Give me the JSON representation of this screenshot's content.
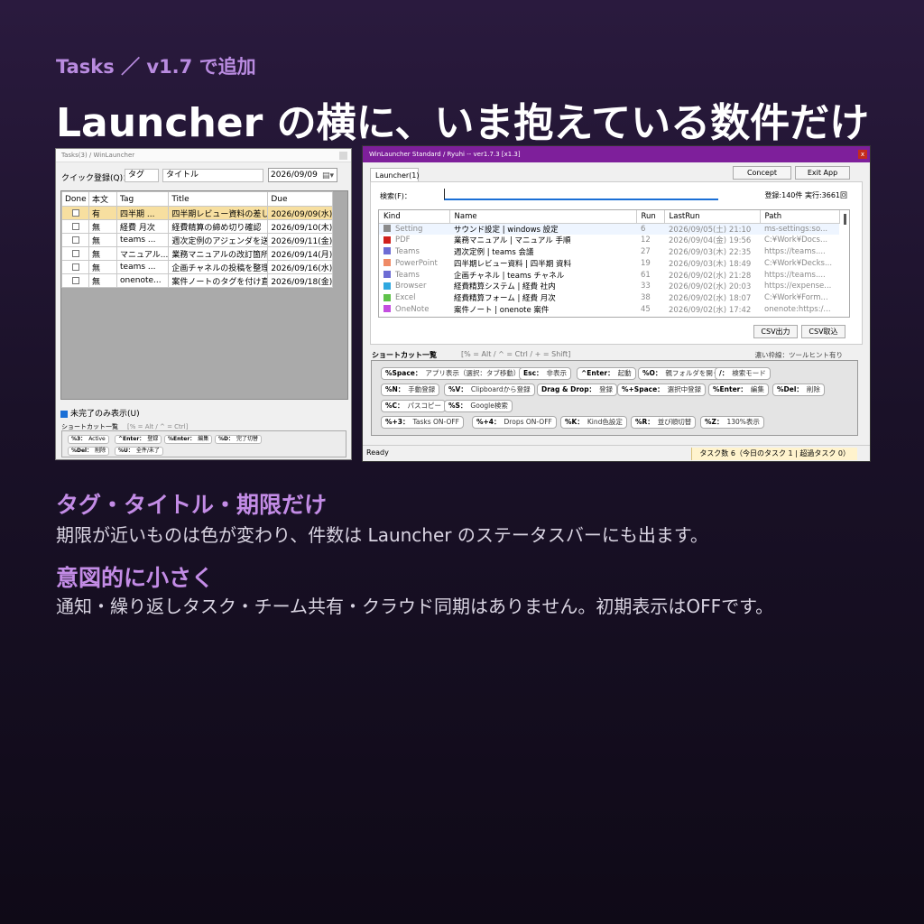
{
  "header": {
    "eyebrow": "Tasks ／ v1.7 で追加",
    "headline": "Launcher の横に、いま抱えている数件だけ"
  },
  "tasks_window": {
    "title": "Tasks(3) / WinLauncher",
    "quick_label": "クイック登録(Q)：",
    "tag_placeholder": "タグ",
    "title_placeholder": "タイトル",
    "due_date": "2026/09/09",
    "columns": [
      "Done",
      "本文",
      "Tag",
      "Title",
      "Due"
    ],
    "rows": [
      {
        "body": "有",
        "tag": "四半期 ...",
        "title": "四半期レビュー資料の差し...",
        "due": "2026/09/09(水)",
        "selected": true
      },
      {
        "body": "無",
        "tag": "経費 月次",
        "title": "経費精算の締め切り確認",
        "due": "2026/09/10(木)",
        "selected": false
      },
      {
        "body": "無",
        "tag": "teams ...",
        "title": "週次定例のアジェンダを送る",
        "due": "2026/09/11(金)",
        "selected": false
      },
      {
        "body": "無",
        "tag": "マニュアル...",
        "title": "業務マニュアルの改訂箇所...",
        "due": "2026/09/14(月)",
        "selected": false
      },
      {
        "body": "無",
        "tag": "teams ...",
        "title": "企画チャネルの投稿を整理",
        "due": "2026/09/16(水)",
        "selected": false
      },
      {
        "body": "無",
        "tag": "onenote...",
        "title": "案件ノートのタグを付け直す",
        "due": "2026/09/18(金)",
        "selected": false
      }
    ],
    "undone_only": "未完了のみ表示(U)",
    "shortcut_title": "ショートカット一覧",
    "shortcut_hint": "[% = Alt / ^ = Ctrl]",
    "shortcuts": [
      {
        "key": "%3：",
        "desc": "Active"
      },
      {
        "key": "^Enter：",
        "desc": "登録"
      },
      {
        "key": "%Enter：",
        "desc": "編集"
      },
      {
        "key": "%D：",
        "desc": "完了切替"
      },
      {
        "key": "%Del：",
        "desc": "削除"
      },
      {
        "key": "%U：",
        "desc": "全件/未了"
      }
    ]
  },
  "launcher_window": {
    "title": "WinLauncher Standard / Ryuhi -- ver1.7.3 [x1.3]",
    "close": "x",
    "tab": "Launcher(1)",
    "concept_btn": "Concept",
    "exit_btn": "Exit App",
    "search_label": "検索(F)：",
    "stats": "登録:140件 実行:3661回",
    "columns": [
      "Kind",
      "Name",
      "Run",
      "LastRun",
      "Path"
    ],
    "rows": [
      {
        "kind": "Setting",
        "color": "#8a8a8a",
        "name": "サウンド設定 | windows 設定",
        "run": "6",
        "last": "2026/09/05(土) 21:10",
        "path": "ms-settings:so..."
      },
      {
        "kind": "PDF",
        "color": "#d0201c",
        "name": "業務マニュアル | マニュアル 手順",
        "run": "12",
        "last": "2026/09/04(金) 19:56",
        "path": "C:¥Work¥Docs..."
      },
      {
        "kind": "Teams",
        "color": "#6d6cd4",
        "name": "週次定例 | teams 会議",
        "run": "27",
        "last": "2026/09/03(木) 22:35",
        "path": "https://teams...."
      },
      {
        "kind": "PowerPoint",
        "color": "#ef8a66",
        "name": "四半期レビュー資料 | 四半期 資料",
        "run": "19",
        "last": "2026/09/03(木) 18:49",
        "path": "C:¥Work¥Decks..."
      },
      {
        "kind": "Teams",
        "color": "#6d6cd4",
        "name": "企画チャネル | teams チャネル",
        "run": "61",
        "last": "2026/09/02(水) 21:28",
        "path": "https://teams...."
      },
      {
        "kind": "Browser",
        "color": "#2fa8e0",
        "name": "経費精算システム | 経費 社内",
        "run": "33",
        "last": "2026/09/02(水) 20:03",
        "path": "https://expense..."
      },
      {
        "kind": "Excel",
        "color": "#5fc24a",
        "name": "経費精算フォーム | 経費 月次",
        "run": "38",
        "last": "2026/09/02(水) 18:07",
        "path": "C:¥Work¥Form..."
      },
      {
        "kind": "OneNote",
        "color": "#c44ee0",
        "name": "案件ノート | onenote 案件",
        "run": "45",
        "last": "2026/09/02(水) 17:42",
        "path": "onenote:https:/..."
      }
    ],
    "csv_out": "CSV出力",
    "csv_in": "CSV取込",
    "shortcut_title": "ショートカット一覧",
    "shortcut_hint": "[% = Alt / ^ = Ctrl / + = Shift]",
    "shortcut_note": "濃い枠線：ツールヒント有り",
    "shortcuts": [
      {
        "key": "%Space：",
        "desc": "アプリ表示（選択：タブ移動）"
      },
      {
        "key": "Esc：",
        "desc": "非表示"
      },
      {
        "key": "^Enter：",
        "desc": "起動"
      },
      {
        "key": "%O：",
        "desc": "親フォルダを開く"
      },
      {
        "key": "/：",
        "desc": "検索モード"
      },
      {
        "key": "%N：",
        "desc": "手動登録"
      },
      {
        "key": "%V：",
        "desc": "Clipboardから登録"
      },
      {
        "key": "Drag & Drop：",
        "desc": "登録"
      },
      {
        "key": "%+Space：",
        "desc": "選択中登録"
      },
      {
        "key": "%Enter：",
        "desc": "編集"
      },
      {
        "key": "%Del：",
        "desc": "削除"
      },
      {
        "key": "%C：",
        "desc": "パスコピー"
      },
      {
        "key": "%S：",
        "desc": "Google検索"
      },
      {
        "key": "%+3：",
        "desc": "Tasks ON-OFF"
      },
      {
        "key": "%+4：",
        "desc": "Drops ON-OFF"
      },
      {
        "key": "%K：",
        "desc": "Kind色設定"
      },
      {
        "key": "%R：",
        "desc": "並び順切替"
      },
      {
        "key": "%Z：",
        "desc": "130%表示"
      }
    ],
    "status_ready": "Ready",
    "status_count": "タスク数 6（今日のタスク 1 | 超過タスク 0）"
  },
  "features": {
    "h1": "タグ・タイトル・期限だけ",
    "p1": "期限が近いものは色が変わり、件数は Launcher のステータスバーにも出ます。",
    "h2": "意図的に小さく",
    "p2": "通知・繰り返しタスク・チーム共有・クラウド同期はありません。初期表示はOFFです。"
  }
}
